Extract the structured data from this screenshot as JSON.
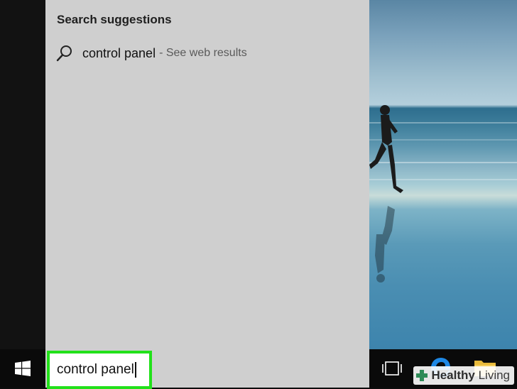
{
  "search_panel": {
    "heading": "Search suggestions",
    "suggestions": [
      {
        "query": "control panel",
        "hint": "- See web results",
        "icon": "search-icon"
      }
    ]
  },
  "taskbar": {
    "start_icon": "windows-logo-icon",
    "search_box": {
      "value": "control panel"
    },
    "taskview_icon": "task-view-icon",
    "edge_icon": "edge-browser-icon",
    "explorer_icon": "file-explorer-icon"
  },
  "watermark": {
    "brand": "Healthy",
    "tail": " Living"
  },
  "colors": {
    "panel_bg": "#cfcfcf",
    "highlight_border": "#22e11a",
    "taskbar_bg": "#0a0a0a",
    "start_strip_bg": "#121212"
  }
}
